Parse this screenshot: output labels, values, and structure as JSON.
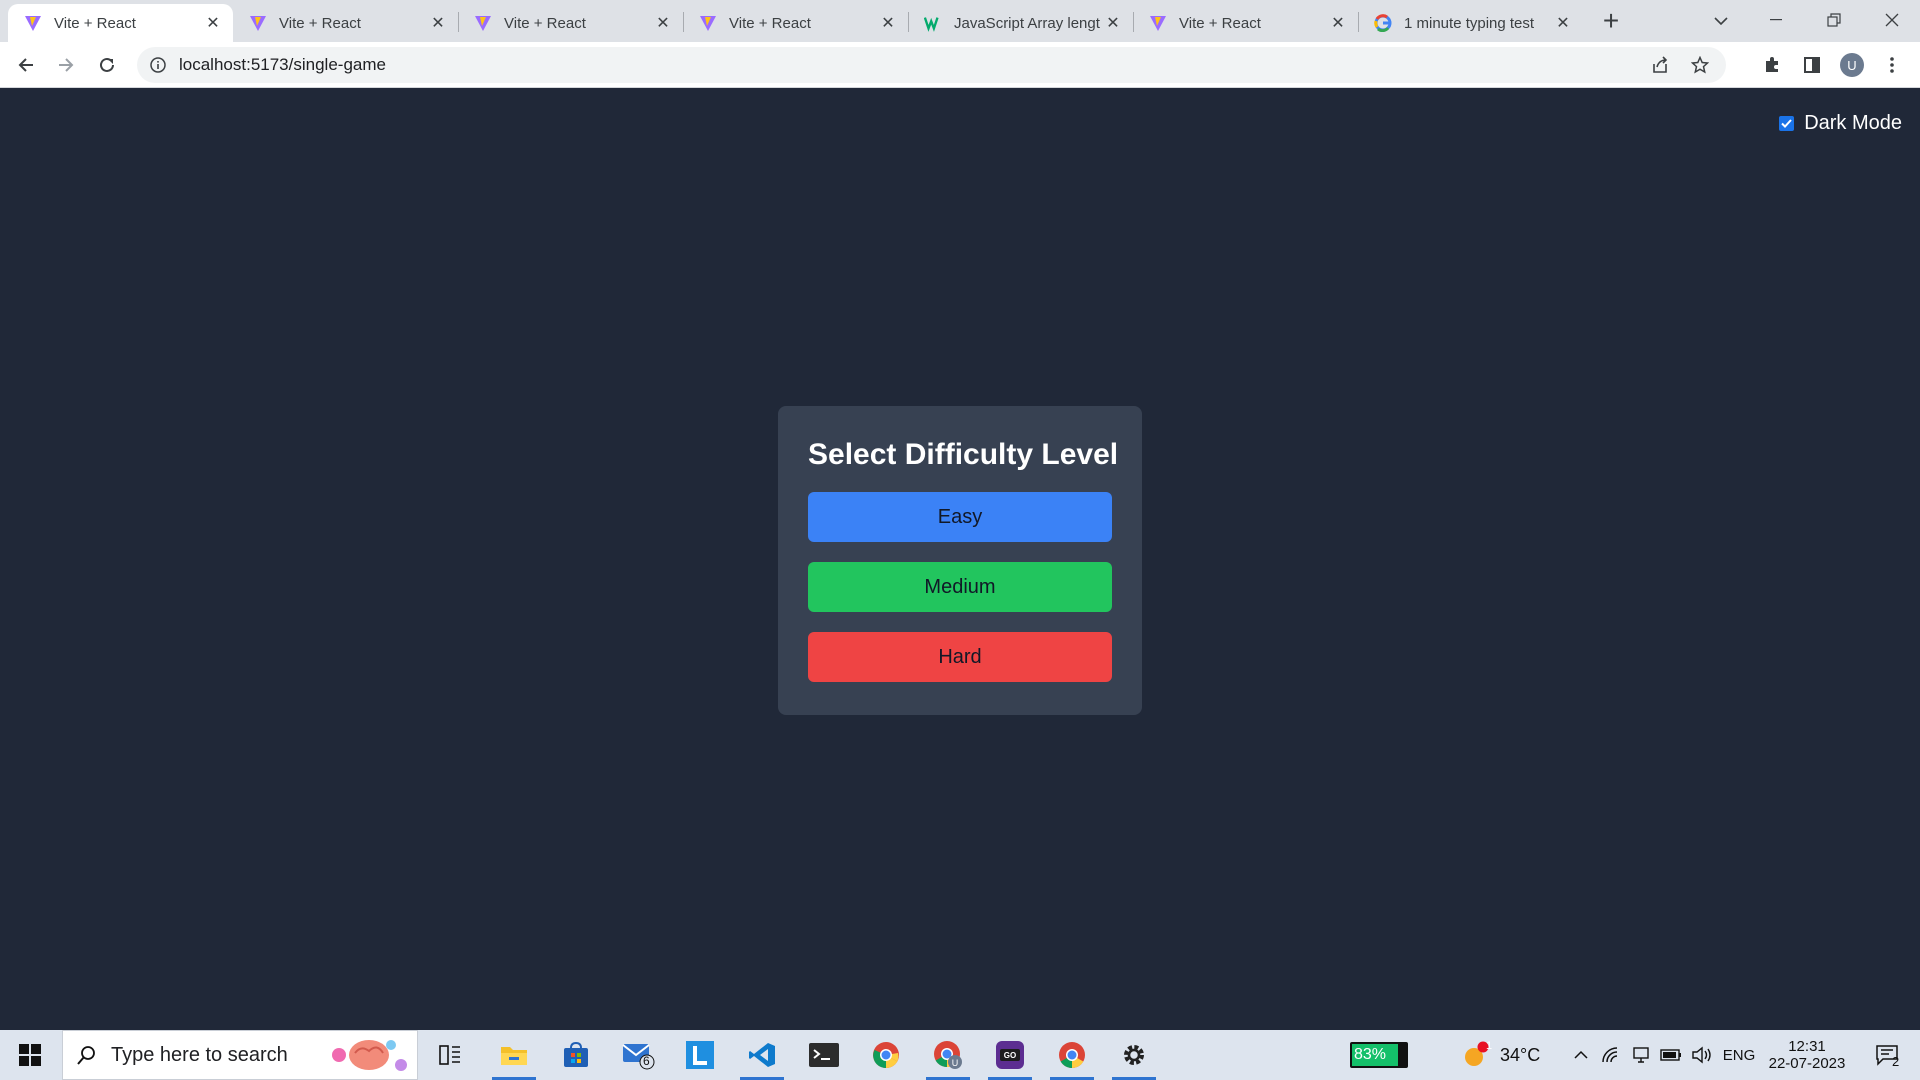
{
  "browser": {
    "tabs": [
      {
        "title": "Vite + React",
        "icon": "vite-icon",
        "active": true
      },
      {
        "title": "Vite + React",
        "icon": "vite-icon",
        "active": false
      },
      {
        "title": "Vite + React",
        "icon": "vite-icon",
        "active": false
      },
      {
        "title": "Vite + React",
        "icon": "vite-icon",
        "active": false
      },
      {
        "title": "JavaScript Array lengt",
        "icon": "w3schools-icon",
        "active": false
      },
      {
        "title": "Vite + React",
        "icon": "vite-icon",
        "active": false
      },
      {
        "title": "1 minute typing test",
        "icon": "google-icon",
        "active": false
      }
    ],
    "url": "localhost:5173/single-game",
    "profile_initial": "U"
  },
  "page": {
    "dark_mode_label": "Dark Mode",
    "dark_mode_checked": true,
    "card_title": "Select Difficulty Level",
    "buttons": {
      "easy": "Easy",
      "medium": "Medium",
      "hard": "Hard"
    },
    "colors": {
      "background": "#202838",
      "card": "#374152",
      "easy": "#3b82f6",
      "medium": "#22c55e",
      "hard": "#ef4444"
    }
  },
  "taskbar": {
    "search_placeholder": "Type here to search",
    "mail_badge": "6",
    "battery": "83%",
    "weather_temp": "34°C",
    "weather_badge": "1",
    "language": "ENG",
    "time": "12:31",
    "date": "22-07-2023",
    "notification_count": "2"
  }
}
